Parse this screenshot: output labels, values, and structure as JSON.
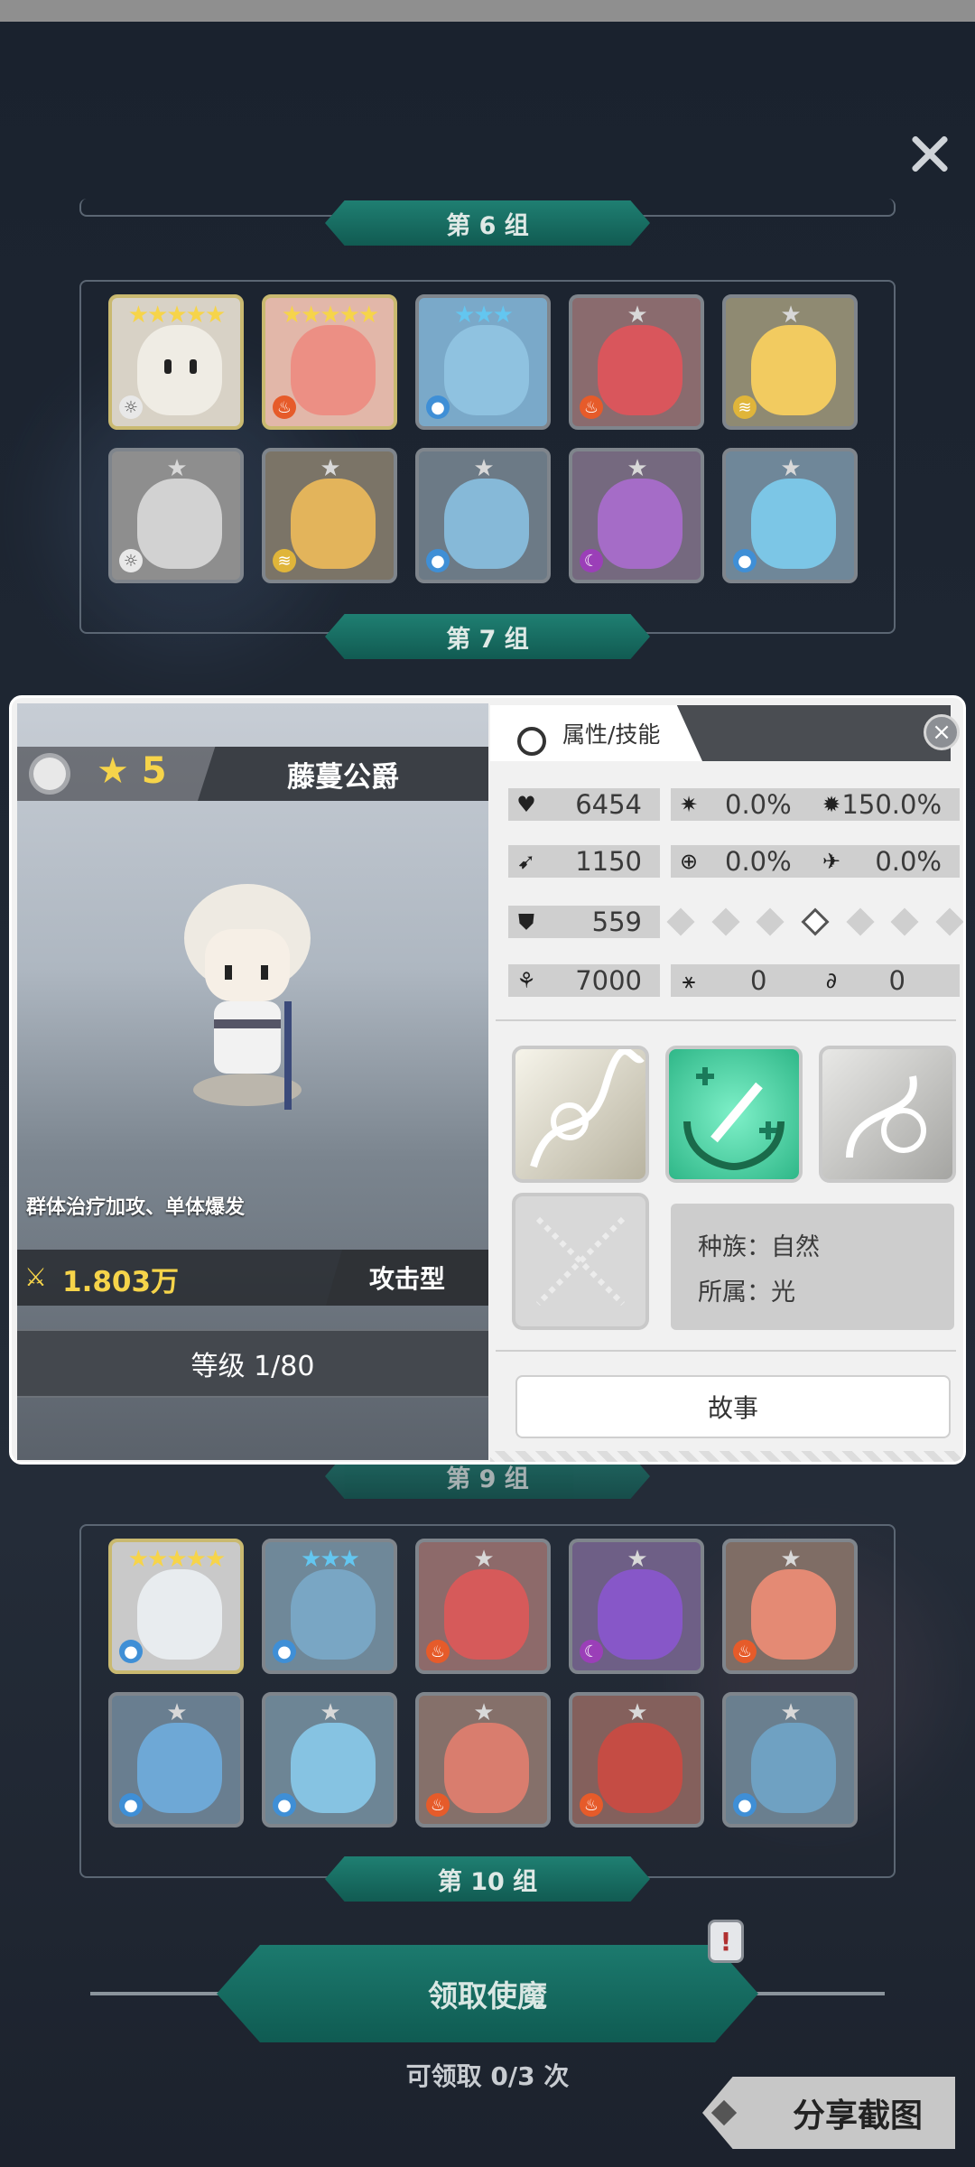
{
  "header": {
    "close_symbol": "✕"
  },
  "groups": [
    {
      "label": "第 6 组"
    },
    {
      "label": "第 7 组"
    },
    {
      "label": "第 9 组"
    },
    {
      "label": "第 10 组"
    }
  ],
  "hero": {
    "stars": "★ 5",
    "name": "藤蔓公爵",
    "description": "群体治疗加攻、单体爆发",
    "power": "1.803万",
    "type": "攻击型",
    "level": "等级 1/80"
  },
  "panel": {
    "tab_label": "属性/技能",
    "close_symbol": "×",
    "stats": {
      "hp": "6454",
      "crit_rate": "0.0%",
      "crit_damage": "150.0%",
      "attack": "1150",
      "accuracy": "0.0%",
      "dodge": "0.0%",
      "defense": "559",
      "speed": "7000",
      "stat_a": "0",
      "stat_b": "0"
    },
    "race": "种族：自然",
    "belong": "所属：光",
    "story_button": "故事"
  },
  "footer": {
    "claim_button": "领取使魔",
    "badge": "!",
    "claim_count": "可领取 0/3 次",
    "share_button": "分享截图"
  },
  "icons": [
    "close-icon",
    "heart-icon",
    "crit-icon",
    "crit-damage-icon",
    "attack-icon",
    "accuracy-icon",
    "dodge-icon",
    "shield-icon",
    "speed-icon",
    "stat-a-icon",
    "stat-b-icon",
    "sun-icon",
    "power-icon"
  ],
  "colors": {
    "accent_teal": "#1c7a6e",
    "star_gold": "#f6d44a",
    "skill_green": "#4cd6a8"
  }
}
